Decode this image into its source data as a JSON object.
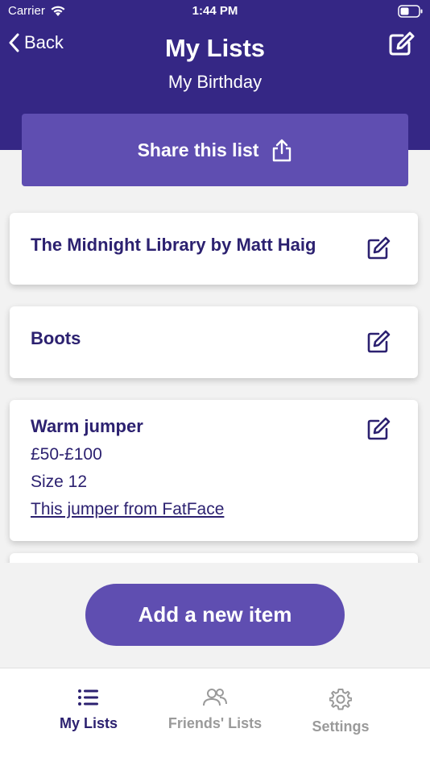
{
  "status_bar": {
    "carrier": "Carrier",
    "time": "1:44 PM"
  },
  "nav": {
    "back_label": "Back",
    "title": "My Lists",
    "subtitle": "My Birthday",
    "edit_icon": "compose-icon"
  },
  "share": {
    "label": "Share this list",
    "icon": "share-icon"
  },
  "items": [
    {
      "title": "The Midnight Library by Matt Haig",
      "lines": []
    },
    {
      "title": "Boots",
      "lines": []
    },
    {
      "title": "Warm jumper",
      "price": "£50-£100",
      "size": "Size 12",
      "link": "This jumper from FatFace"
    }
  ],
  "add_button": {
    "label": "Add a new item"
  },
  "tabs": [
    {
      "label": "My Lists",
      "icon": "list-icon",
      "active": true
    },
    {
      "label": "Friends' Lists",
      "icon": "people-icon",
      "active": false
    },
    {
      "label": "Settings",
      "icon": "gear-icon",
      "active": false
    }
  ],
  "colors": {
    "header": "#352785",
    "accent": "#5f4eb1",
    "text_dark": "#2c2170",
    "inactive": "#9a9a9a"
  }
}
